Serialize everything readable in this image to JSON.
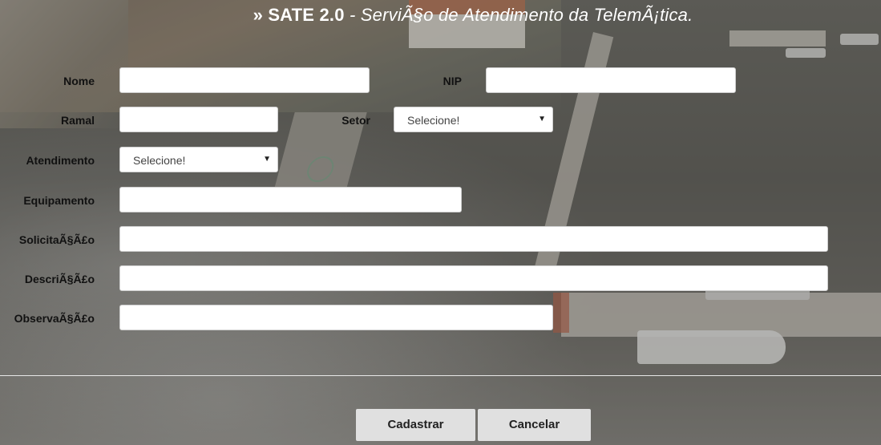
{
  "header": {
    "raquo": "»",
    "app_name": "SATE 2.0",
    "tagline": " - ServiÃ§o de Atendimento da TelemÃ¡tica."
  },
  "form": {
    "nome": {
      "label": "Nome",
      "value": ""
    },
    "nip": {
      "label": "NIP",
      "value": ""
    },
    "ramal": {
      "label": "Ramal",
      "value": ""
    },
    "setor": {
      "label": "Setor",
      "selected": "Selecione!"
    },
    "atendimento": {
      "label": "Atendimento",
      "selected": "Selecione!"
    },
    "equipamento": {
      "label": "Equipamento",
      "value": ""
    },
    "solicitacao": {
      "label": "SolicitaÃ§Ã£o",
      "value": ""
    },
    "descricao": {
      "label": "DescriÃ§Ã£o",
      "value": ""
    },
    "observacao": {
      "label": "ObservaÃ§Ã£o",
      "value": ""
    }
  },
  "actions": {
    "submit_label": "Cadastrar",
    "cancel_label": "Cancelar"
  },
  "icons": {
    "dropdown": "caret-down-icon"
  },
  "colors": {
    "title_text": "#ffffff",
    "label_text": "#111111",
    "button_bg": "#e0e0e0",
    "input_bg": "#ffffff"
  }
}
